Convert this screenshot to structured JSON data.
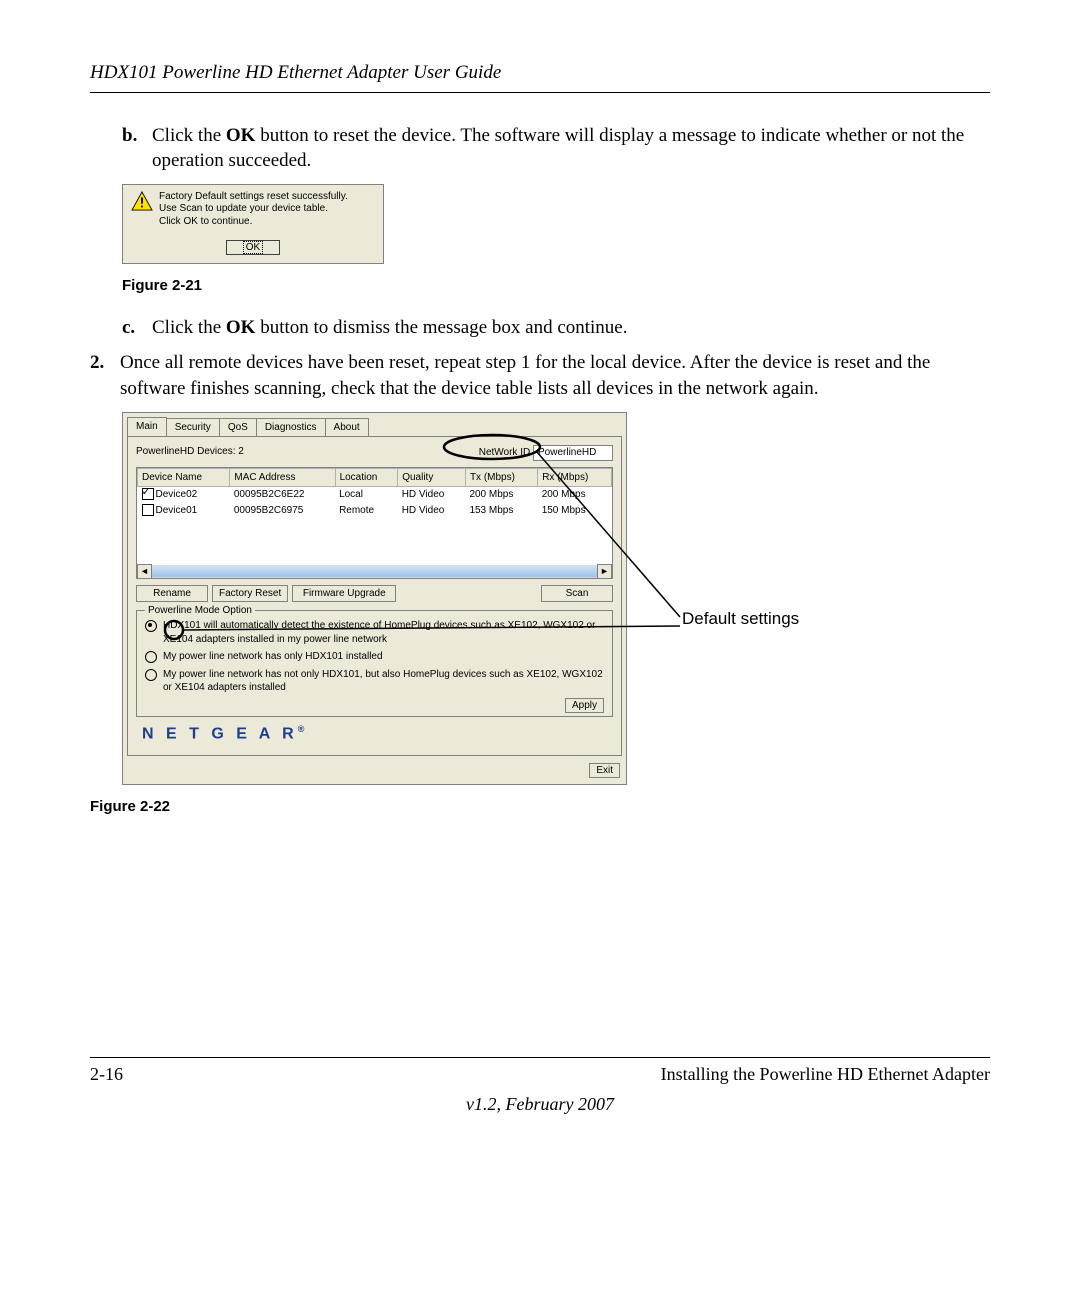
{
  "header": {
    "title": "HDX101 Powerline HD Ethernet Adapter User Guide"
  },
  "items": {
    "b": {
      "marker": "b.",
      "pre": "Click the ",
      "bold": "OK",
      "post": " button to reset the device. The software will display a message to indicate whether or not the operation succeeded."
    },
    "c": {
      "marker": "c.",
      "pre": "Click the ",
      "bold": "OK",
      "post": " button to dismiss the message box and continue."
    },
    "two": {
      "marker": "2.",
      "text": "Once all remote devices have been reset, repeat step 1 for the local device. After the device is reset and the software finishes scanning, check that the device table lists all devices in the network again."
    }
  },
  "msgbox": {
    "line1": "Factory Default settings reset successfully.",
    "line2": "Use Scan to update your device table.",
    "line3": "Click OK to continue.",
    "ok": "OK"
  },
  "fig21": "Figure 2-21",
  "fig22": "Figure 2-22",
  "app": {
    "tabs": {
      "t0": "Main",
      "t1": "Security",
      "t2": "QoS",
      "t3": "Diagnostics",
      "t4": "About"
    },
    "devcount_label": "PowerlineHD Devices: 2",
    "networkid_label": "NetWork ID",
    "networkid_value": "PowerlineHD",
    "cols": {
      "c0": "Device Name",
      "c1": "MAC Address",
      "c2": "Location",
      "c3": "Quality",
      "c4": "Tx (Mbps)",
      "c5": "Rx (Mbps)"
    },
    "rows": [
      {
        "name": "Device02",
        "mac": "00095B2C6E22",
        "loc": "Local",
        "quality": "HD Video",
        "tx": "200 Mbps",
        "rx": "200 Mbps",
        "checked": true
      },
      {
        "name": "Device01",
        "mac": "00095B2C6975",
        "loc": "Remote",
        "quality": "HD Video",
        "tx": "153 Mbps",
        "rx": "150 Mbps",
        "checked": false
      }
    ],
    "buttons": {
      "rename": "Rename",
      "factory": "Factory Reset",
      "firmware": "Firmware Upgrade",
      "scan": "Scan",
      "apply": "Apply",
      "exit": "Exit"
    },
    "group": {
      "legend": "Powerline Mode Option",
      "opt1": "HDX101 will automatically detect the existence of HomePlug devices such as XE102, WGX102 or XE104 adapters installed in my power line network",
      "opt2": "My power line network has only HDX101 installed",
      "opt3": "My power line network has not only HDX101, but also HomePlug devices such as XE102, WGX102 or XE104 adapters installed"
    },
    "brand": "N E T G E A R"
  },
  "annotation": {
    "label": "Default settings"
  },
  "footer": {
    "page": "2-16",
    "section": "Installing the Powerline HD Ethernet Adapter",
    "version": "v1.2, February 2007"
  }
}
